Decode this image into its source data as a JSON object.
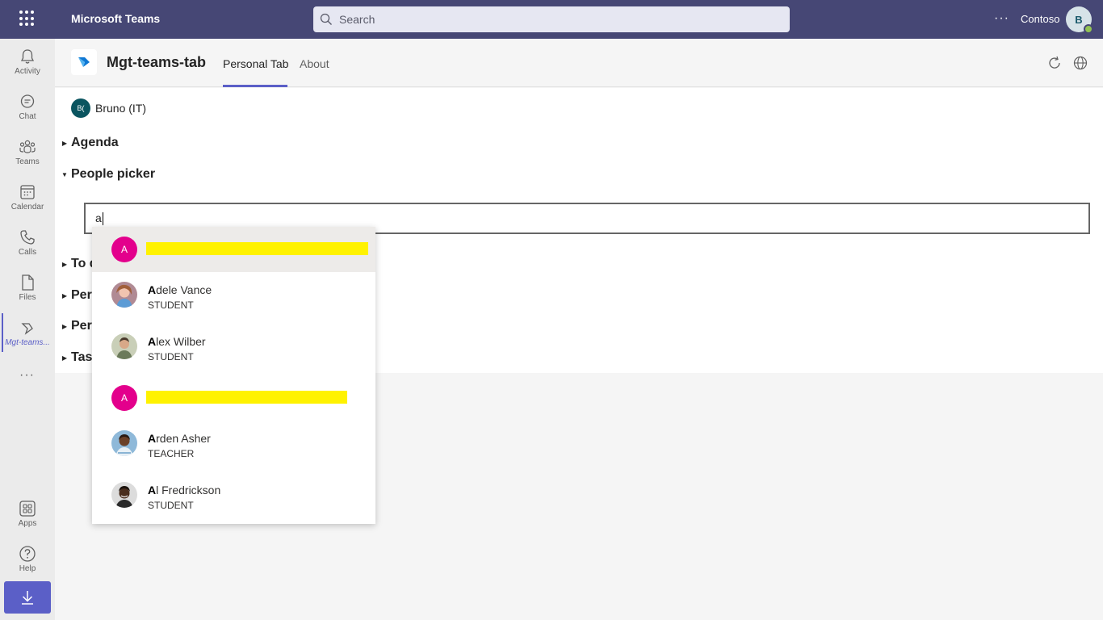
{
  "topbar": {
    "app_name": "Microsoft Teams",
    "search_placeholder": "Search",
    "org_name": "Contoso",
    "me_initial": "B",
    "more": "···"
  },
  "rail": {
    "items": [
      {
        "label": "Activity",
        "icon": "bell-icon"
      },
      {
        "label": "Chat",
        "icon": "chat-icon"
      },
      {
        "label": "Teams",
        "icon": "teams-icon"
      },
      {
        "label": "Calendar",
        "icon": "calendar-icon"
      },
      {
        "label": "Calls",
        "icon": "phone-icon"
      },
      {
        "label": "Files",
        "icon": "file-icon"
      },
      {
        "label": "Mgt-teams...",
        "icon": "app-icon"
      }
    ],
    "more": "···",
    "bottom": [
      {
        "label": "Apps",
        "icon": "apps-icon"
      },
      {
        "label": "Help",
        "icon": "help-icon"
      }
    ]
  },
  "app_header": {
    "title": "Mgt-teams-tab",
    "tabs": [
      "Personal Tab",
      "About"
    ],
    "active_tab": "Personal Tab"
  },
  "content": {
    "user": {
      "initials": "B(",
      "name": "Bruno (IT)"
    },
    "sections": [
      {
        "label": "Agenda",
        "expanded": false
      },
      {
        "label": "People picker",
        "expanded": true
      },
      {
        "label": "To do",
        "expanded": false
      },
      {
        "label": "Person",
        "expanded": false
      },
      {
        "label": "Person",
        "expanded": false
      },
      {
        "label": "Tasks",
        "expanded": false
      }
    ],
    "picker_value": "a"
  },
  "dropdown": {
    "items": [
      {
        "initial": "A",
        "redacted": true,
        "highlight": "",
        "rest": "",
        "role": ""
      },
      {
        "initial": "",
        "redacted": false,
        "highlight": "A",
        "rest": "dele Vance",
        "role": "STUDENT"
      },
      {
        "initial": "",
        "redacted": false,
        "highlight": "A",
        "rest": "lex Wilber",
        "role": "STUDENT"
      },
      {
        "initial": "A",
        "redacted": true,
        "highlight": "",
        "rest": "",
        "role": ""
      },
      {
        "initial": "",
        "redacted": false,
        "highlight": "A",
        "rest": "rden Asher",
        "role": "TEACHER"
      },
      {
        "initial": "",
        "redacted": false,
        "highlight": "A",
        "rest": "l Fredrickson",
        "role": "STUDENT"
      }
    ]
  },
  "colors": {
    "topbar": "#464775",
    "accent": "#5b5fc7",
    "initial_avatar": "#e3008c",
    "redaction": "#fff200"
  }
}
